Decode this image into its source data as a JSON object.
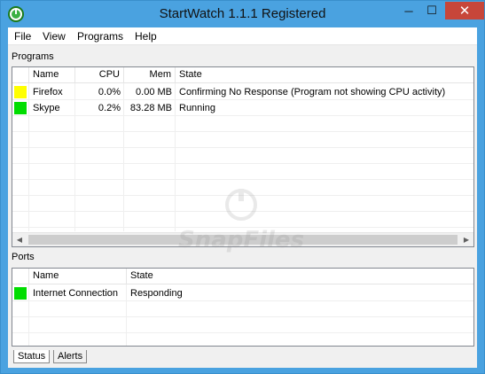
{
  "window": {
    "title": "StartWatch 1.1.1 Registered",
    "controls": {
      "minimize": "─",
      "maximize": "☐",
      "close": "✕"
    }
  },
  "menu": [
    "File",
    "View",
    "Programs",
    "Help"
  ],
  "programs": {
    "label": "Programs",
    "columns": [
      "Name",
      "CPU",
      "Mem",
      "State"
    ],
    "rows": [
      {
        "status_color": "#ffff00",
        "name": "Firefox",
        "cpu": "0.0%",
        "mem": "0.00 MB",
        "state": "Confirming No Response (Program not showing CPU activity)"
      },
      {
        "status_color": "#00dd00",
        "name": "Skype",
        "cpu": "0.2%",
        "mem": "83.28 MB",
        "state": "Running"
      }
    ]
  },
  "ports": {
    "label": "Ports",
    "columns": [
      "Name",
      "State"
    ],
    "rows": [
      {
        "status_color": "#00dd00",
        "name": "Internet Connection",
        "state": "Responding"
      }
    ]
  },
  "tabs": [
    "Status",
    "Alerts"
  ],
  "watermark": {
    "text": "SnapFiles"
  },
  "icons": {
    "app": "stopwatch-icon",
    "scroll_left": "scroll-left-arrow-icon",
    "scroll_right": "scroll-right-arrow-icon"
  }
}
